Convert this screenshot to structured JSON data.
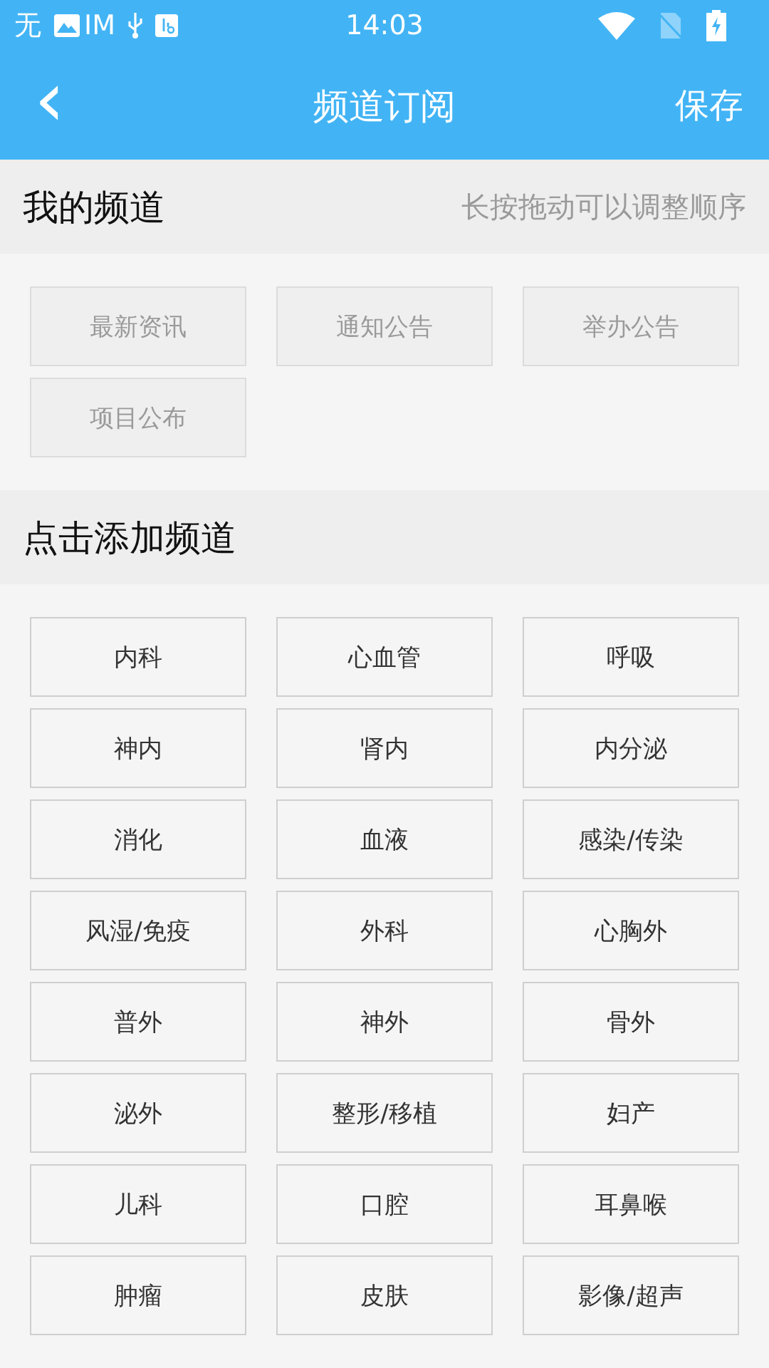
{
  "status_bar": {
    "carrier_parts": [
      "无",
      "IM"
    ],
    "time": "14:03"
  },
  "header": {
    "back": "‹",
    "title": "频道订阅",
    "action": "保存"
  },
  "my_channels": {
    "title": "我的频道",
    "hint": "长按拖动可以调整顺序",
    "items": [
      {
        "label": "最新资讯",
        "disabled": true
      },
      {
        "label": "通知公告",
        "disabled": true
      },
      {
        "label": "举办公告",
        "disabled": true
      },
      {
        "label": "项目公布",
        "disabled": true
      }
    ]
  },
  "add_channels": {
    "title": "点击添加频道",
    "items": [
      {
        "label": "内科",
        "disabled": false
      },
      {
        "label": "心血管",
        "disabled": false
      },
      {
        "label": "呼吸",
        "disabled": false
      },
      {
        "label": "神内",
        "disabled": false
      },
      {
        "label": "肾内",
        "disabled": false
      },
      {
        "label": "内分泌",
        "disabled": false
      },
      {
        "label": "消化",
        "disabled": false
      },
      {
        "label": "血液",
        "disabled": false
      },
      {
        "label": "感染/传染",
        "disabled": false
      },
      {
        "label": "风湿/免疫",
        "disabled": false
      },
      {
        "label": "外科",
        "disabled": false
      },
      {
        "label": "心胸外",
        "disabled": false
      },
      {
        "label": "普外",
        "disabled": false
      },
      {
        "label": "神外",
        "disabled": false
      },
      {
        "label": "骨外",
        "disabled": false
      },
      {
        "label": "泌外",
        "disabled": false
      },
      {
        "label": "整形/移植",
        "disabled": false
      },
      {
        "label": "妇产",
        "disabled": false
      },
      {
        "label": "儿科",
        "disabled": false
      },
      {
        "label": "口腔",
        "disabled": false
      },
      {
        "label": "耳鼻喉",
        "disabled": false
      },
      {
        "label": "肿瘤",
        "disabled": false
      },
      {
        "label": "皮肤",
        "disabled": false
      },
      {
        "label": "影像/超声",
        "disabled": false
      }
    ]
  }
}
